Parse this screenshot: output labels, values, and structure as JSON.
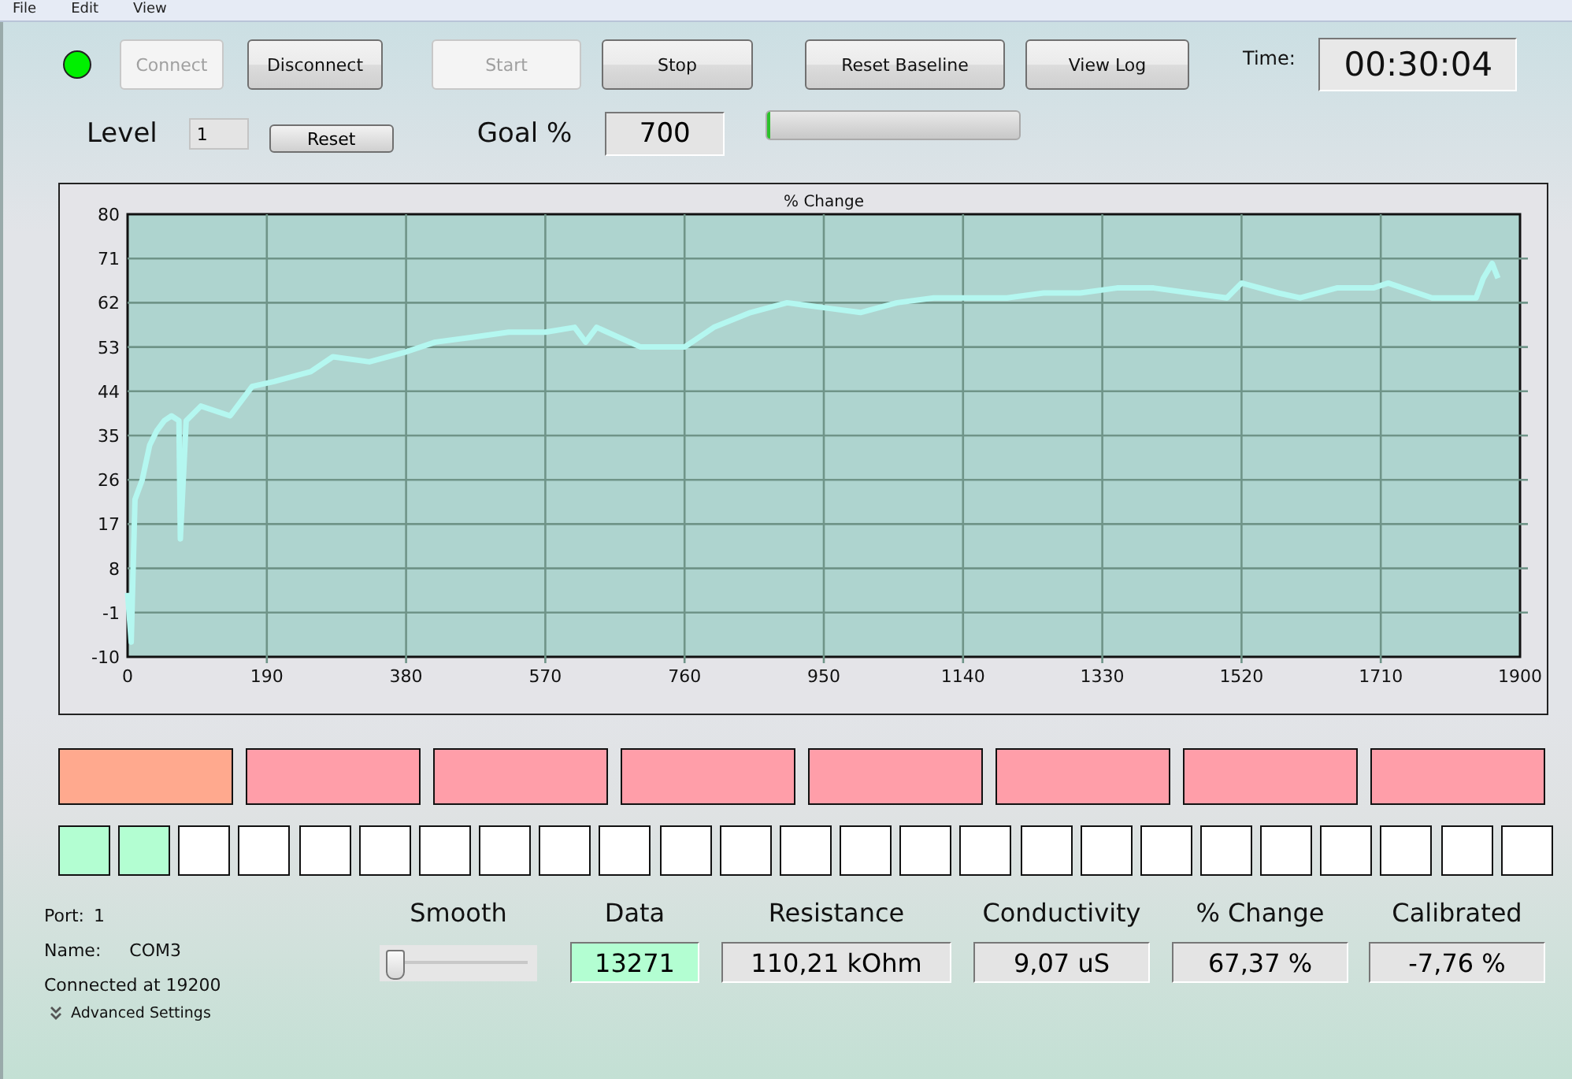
{
  "menu": [
    {
      "label": "File"
    },
    {
      "label": "Edit"
    },
    {
      "label": "View"
    }
  ],
  "connection_led": {
    "on": true
  },
  "toolbar": [
    {
      "label": "Connect",
      "disabled": true
    },
    {
      "label": "Disconnect",
      "disabled": false
    },
    {
      "label": "Start",
      "disabled": true
    },
    {
      "label": "Stop",
      "disabled": false
    },
    {
      "label": "Reset Baseline",
      "disabled": false
    },
    {
      "label": "View Log",
      "disabled": false
    }
  ],
  "time": {
    "label": "Time:",
    "value": "00:30:04"
  },
  "level": {
    "label": "Level",
    "value": "1",
    "button": "Reset"
  },
  "goal": {
    "label": "Goal %",
    "value": "700"
  },
  "goal_progress": {
    "level": 0.01
  },
  "chart": {
    "chart_data": {
      "type": "line",
      "grid": true,
      "xlim": [
        0,
        1900
      ],
      "ylim": [
        -10,
        80
      ],
      "xticks": [
        0,
        190,
        380,
        570,
        760,
        950,
        1140,
        1330,
        1520,
        1710,
        1900
      ],
      "yticks": [
        -10,
        -1,
        8,
        17,
        26,
        35,
        44,
        53,
        62,
        71,
        80
      ],
      "x": [
        0,
        5,
        10,
        20,
        30,
        40,
        50,
        60,
        70,
        72,
        80,
        100,
        140,
        170,
        200,
        250,
        280,
        330,
        380,
        420,
        470,
        520,
        570,
        610,
        625,
        640,
        700,
        760,
        800,
        850,
        900,
        950,
        1000,
        1050,
        1100,
        1140,
        1200,
        1250,
        1300,
        1350,
        1400,
        1450,
        1500,
        1520,
        1570,
        1600,
        1650,
        1700,
        1720,
        1780,
        1840,
        1850,
        1862,
        1870
      ],
      "series": [
        {
          "name": "% Change",
          "color": "#b4f7f0",
          "values": [
            3,
            -7,
            22,
            26,
            33,
            36,
            38,
            39,
            38,
            14,
            38,
            41,
            39,
            45,
            46,
            48,
            51,
            50,
            52,
            54,
            55,
            56,
            56,
            57,
            54,
            57,
            53,
            53,
            57,
            60,
            62,
            61,
            60,
            62,
            63,
            63,
            63,
            64,
            64,
            65,
            65,
            64,
            63,
            66,
            64,
            63,
            65,
            65,
            66,
            63,
            63,
            67,
            70,
            67
          ]
        }
      ]
    }
  },
  "level_blocks": [
    {
      "color": "#ffa98e"
    },
    {
      "color": "#ff9ea9"
    },
    {
      "color": "#ff9ea9"
    },
    {
      "color": "#ff9ea9"
    },
    {
      "color": "#ff9ea9"
    },
    {
      "color": "#ff9ea9"
    },
    {
      "color": "#ff9ea9"
    },
    {
      "color": "#ff9ea9"
    }
  ],
  "step_squares": [
    {
      "color": "#b3fed2"
    },
    {
      "color": "#b3fed2"
    },
    {
      "color": "#ffffff"
    },
    {
      "color": "#ffffff"
    },
    {
      "color": "#ffffff"
    },
    {
      "color": "#ffffff"
    },
    {
      "color": "#ffffff"
    },
    {
      "color": "#ffffff"
    },
    {
      "color": "#ffffff"
    },
    {
      "color": "#ffffff"
    },
    {
      "color": "#ffffff"
    },
    {
      "color": "#ffffff"
    },
    {
      "color": "#ffffff"
    },
    {
      "color": "#ffffff"
    },
    {
      "color": "#ffffff"
    },
    {
      "color": "#ffffff"
    },
    {
      "color": "#ffffff"
    },
    {
      "color": "#ffffff"
    },
    {
      "color": "#ffffff"
    },
    {
      "color": "#ffffff"
    },
    {
      "color": "#ffffff"
    },
    {
      "color": "#ffffff"
    },
    {
      "color": "#ffffff"
    },
    {
      "color": "#ffffff"
    },
    {
      "color": "#ffffff"
    }
  ],
  "port_info": {
    "port_label": "Port:",
    "port": "1",
    "name_label": "Name:",
    "name": "COM3",
    "status": "Connected at 19200"
  },
  "advanced_settings": {
    "label": "Advanced Settings",
    "expanded": false
  },
  "smooth": {
    "label": "Smooth",
    "level": 0.05
  },
  "readouts": [
    {
      "label": "Data",
      "value": "13271",
      "highlighted": true
    },
    {
      "label": "Resistance",
      "value": "110,21 kOhm",
      "highlighted": false
    },
    {
      "label": "Conductivity",
      "value": "9,07 uS",
      "highlighted": false
    },
    {
      "label": "% Change",
      "value": "67,37 %",
      "highlighted": false
    },
    {
      "label": "Calibrated",
      "value": "-7,76 %",
      "highlighted": false
    }
  ]
}
